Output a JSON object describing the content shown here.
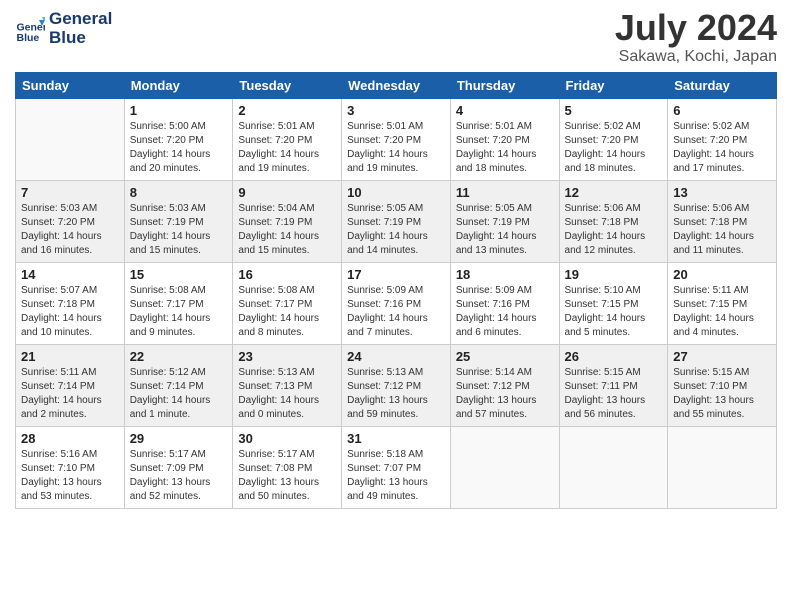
{
  "header": {
    "logo_line1": "General",
    "logo_line2": "Blue",
    "month_title": "July 2024",
    "location": "Sakawa, Kochi, Japan"
  },
  "weekdays": [
    "Sunday",
    "Monday",
    "Tuesday",
    "Wednesday",
    "Thursday",
    "Friday",
    "Saturday"
  ],
  "weeks": [
    [
      {
        "day": "",
        "info": ""
      },
      {
        "day": "1",
        "info": "Sunrise: 5:00 AM\nSunset: 7:20 PM\nDaylight: 14 hours\nand 20 minutes."
      },
      {
        "day": "2",
        "info": "Sunrise: 5:01 AM\nSunset: 7:20 PM\nDaylight: 14 hours\nand 19 minutes."
      },
      {
        "day": "3",
        "info": "Sunrise: 5:01 AM\nSunset: 7:20 PM\nDaylight: 14 hours\nand 19 minutes."
      },
      {
        "day": "4",
        "info": "Sunrise: 5:01 AM\nSunset: 7:20 PM\nDaylight: 14 hours\nand 18 minutes."
      },
      {
        "day": "5",
        "info": "Sunrise: 5:02 AM\nSunset: 7:20 PM\nDaylight: 14 hours\nand 18 minutes."
      },
      {
        "day": "6",
        "info": "Sunrise: 5:02 AM\nSunset: 7:20 PM\nDaylight: 14 hours\nand 17 minutes."
      }
    ],
    [
      {
        "day": "7",
        "info": "Sunrise: 5:03 AM\nSunset: 7:20 PM\nDaylight: 14 hours\nand 16 minutes."
      },
      {
        "day": "8",
        "info": "Sunrise: 5:03 AM\nSunset: 7:19 PM\nDaylight: 14 hours\nand 15 minutes."
      },
      {
        "day": "9",
        "info": "Sunrise: 5:04 AM\nSunset: 7:19 PM\nDaylight: 14 hours\nand 15 minutes."
      },
      {
        "day": "10",
        "info": "Sunrise: 5:05 AM\nSunset: 7:19 PM\nDaylight: 14 hours\nand 14 minutes."
      },
      {
        "day": "11",
        "info": "Sunrise: 5:05 AM\nSunset: 7:19 PM\nDaylight: 14 hours\nand 13 minutes."
      },
      {
        "day": "12",
        "info": "Sunrise: 5:06 AM\nSunset: 7:18 PM\nDaylight: 14 hours\nand 12 minutes."
      },
      {
        "day": "13",
        "info": "Sunrise: 5:06 AM\nSunset: 7:18 PM\nDaylight: 14 hours\nand 11 minutes."
      }
    ],
    [
      {
        "day": "14",
        "info": "Sunrise: 5:07 AM\nSunset: 7:18 PM\nDaylight: 14 hours\nand 10 minutes."
      },
      {
        "day": "15",
        "info": "Sunrise: 5:08 AM\nSunset: 7:17 PM\nDaylight: 14 hours\nand 9 minutes."
      },
      {
        "day": "16",
        "info": "Sunrise: 5:08 AM\nSunset: 7:17 PM\nDaylight: 14 hours\nand 8 minutes."
      },
      {
        "day": "17",
        "info": "Sunrise: 5:09 AM\nSunset: 7:16 PM\nDaylight: 14 hours\nand 7 minutes."
      },
      {
        "day": "18",
        "info": "Sunrise: 5:09 AM\nSunset: 7:16 PM\nDaylight: 14 hours\nand 6 minutes."
      },
      {
        "day": "19",
        "info": "Sunrise: 5:10 AM\nSunset: 7:15 PM\nDaylight: 14 hours\nand 5 minutes."
      },
      {
        "day": "20",
        "info": "Sunrise: 5:11 AM\nSunset: 7:15 PM\nDaylight: 14 hours\nand 4 minutes."
      }
    ],
    [
      {
        "day": "21",
        "info": "Sunrise: 5:11 AM\nSunset: 7:14 PM\nDaylight: 14 hours\nand 2 minutes."
      },
      {
        "day": "22",
        "info": "Sunrise: 5:12 AM\nSunset: 7:14 PM\nDaylight: 14 hours\nand 1 minute."
      },
      {
        "day": "23",
        "info": "Sunrise: 5:13 AM\nSunset: 7:13 PM\nDaylight: 14 hours\nand 0 minutes."
      },
      {
        "day": "24",
        "info": "Sunrise: 5:13 AM\nSunset: 7:12 PM\nDaylight: 13 hours\nand 59 minutes."
      },
      {
        "day": "25",
        "info": "Sunrise: 5:14 AM\nSunset: 7:12 PM\nDaylight: 13 hours\nand 57 minutes."
      },
      {
        "day": "26",
        "info": "Sunrise: 5:15 AM\nSunset: 7:11 PM\nDaylight: 13 hours\nand 56 minutes."
      },
      {
        "day": "27",
        "info": "Sunrise: 5:15 AM\nSunset: 7:10 PM\nDaylight: 13 hours\nand 55 minutes."
      }
    ],
    [
      {
        "day": "28",
        "info": "Sunrise: 5:16 AM\nSunset: 7:10 PM\nDaylight: 13 hours\nand 53 minutes."
      },
      {
        "day": "29",
        "info": "Sunrise: 5:17 AM\nSunset: 7:09 PM\nDaylight: 13 hours\nand 52 minutes."
      },
      {
        "day": "30",
        "info": "Sunrise: 5:17 AM\nSunset: 7:08 PM\nDaylight: 13 hours\nand 50 minutes."
      },
      {
        "day": "31",
        "info": "Sunrise: 5:18 AM\nSunset: 7:07 PM\nDaylight: 13 hours\nand 49 minutes."
      },
      {
        "day": "",
        "info": ""
      },
      {
        "day": "",
        "info": ""
      },
      {
        "day": "",
        "info": ""
      }
    ]
  ]
}
